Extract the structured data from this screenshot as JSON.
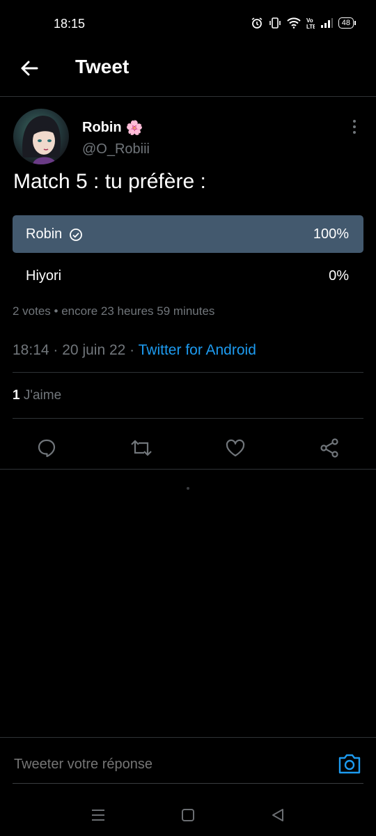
{
  "status_bar": {
    "time": "18:15",
    "battery": "48",
    "icons": [
      "alarm-icon",
      "vibrate-icon",
      "wifi-icon",
      "volte-icon",
      "signal-icon",
      "battery-icon"
    ]
  },
  "header": {
    "title": "Tweet",
    "back_icon": "arrow-left-icon"
  },
  "tweet": {
    "author_name": "Robin",
    "author_emoji": "🌸",
    "handle": "@O_Robiii",
    "text": "Match 5 : tu préfère :",
    "poll": {
      "options": [
        {
          "label": "Robin",
          "percent": "100%",
          "selected": true
        },
        {
          "label": "Hiyori",
          "percent": "0%",
          "selected": false
        }
      ],
      "meta": "2 votes • encore 23 heures 59 minutes"
    },
    "time": "18:14",
    "date": "20 juin 22",
    "separator": "·",
    "source": "Twitter for Android",
    "likes_count": "1",
    "likes_label": "J'aime"
  },
  "actions": [
    "reply-icon",
    "retweet-icon",
    "like-icon",
    "share-icon"
  ],
  "reply": {
    "placeholder": "Tweeter votre réponse"
  },
  "colors": {
    "background": "#000000",
    "accent": "#1d9bf0",
    "poll_winner": "#43596e",
    "muted_text": "#71767b"
  }
}
